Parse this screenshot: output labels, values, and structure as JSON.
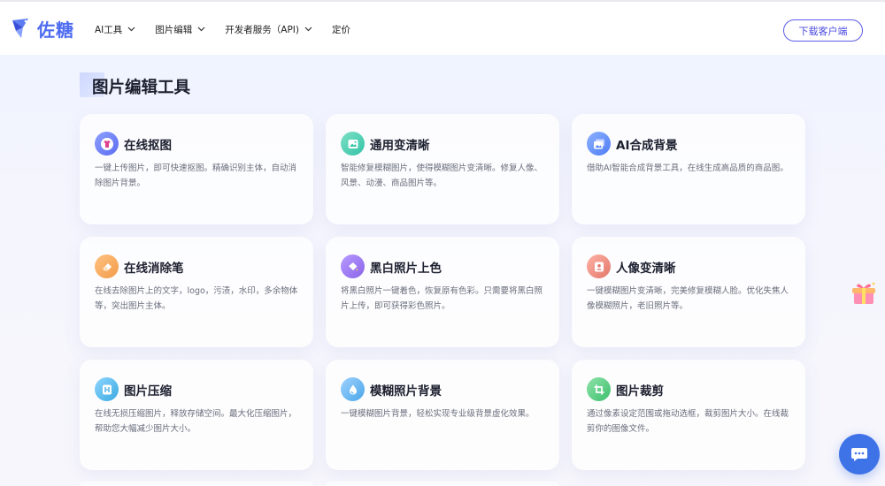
{
  "brand": {
    "name": "佐糖",
    "logo_icon": "bird-logo-icon",
    "color": "#4e6cf0"
  },
  "nav": {
    "items": [
      {
        "label": "AI工具",
        "has_dropdown": true
      },
      {
        "label": "图片编辑",
        "has_dropdown": true
      },
      {
        "label": "开发者服务（API)",
        "has_dropdown": true
      },
      {
        "label": "定价",
        "has_dropdown": false
      }
    ],
    "download_label": "下载客户端"
  },
  "section": {
    "title": "图片编辑工具"
  },
  "cards": [
    {
      "title": "在线抠图",
      "desc": "一键上传图片，即可快速抠图。精确识别主体，自动消除图片背景。",
      "icon": "shirt-icon",
      "color": "#5a6cf0"
    },
    {
      "title": "通用变清晰",
      "desc": "智能修复模糊图片，使得模糊图片变清晰。修复人像、风景、动漫、商品图片等。",
      "icon": "image-icon",
      "color": "#34c3a6"
    },
    {
      "title": "AI合成背景",
      "desc": "借助AI智能合成背景工具，在线生成高品质的商品图。",
      "icon": "photo-stack-icon",
      "color": "#4f7cf5"
    },
    {
      "title": "在线消除笔",
      "desc": "在线去除图片上的文字，logo，污渍，水印，多余物体等，突出图片主体。",
      "icon": "eraser-icon",
      "color": "#f29a47"
    },
    {
      "title": "黑白照片上色",
      "desc": "将黑白照片一键着色，恢复原有色彩。只需要将黑白照片上传，即可获得彩色照片。",
      "icon": "paint-bucket-icon",
      "color": "#8a63e8"
    },
    {
      "title": "人像变清晰",
      "desc": "一键模糊图片变清晰，完美修复模糊人脸。优化失焦人像模糊照片，老旧照片等。",
      "icon": "portrait-icon",
      "color": "#e2766a"
    },
    {
      "title": "图片压缩",
      "desc": "在线无损压缩图片，释放存储空间。最大化压缩图片，帮助您大幅减少图片大小。",
      "icon": "compress-icon",
      "color": "#3aa9e0"
    },
    {
      "title": "模糊照片背景",
      "desc": "一键模糊图片背景，轻松实现专业级背景虚化效果。",
      "icon": "drop-icon",
      "color": "#4aa6e8"
    },
    {
      "title": "图片裁剪",
      "desc": "通过像素设定范围或拖动选框，裁剪图片大小。在线裁剪你的图像文件。",
      "icon": "crop-icon",
      "color": "#3dbf6e"
    }
  ],
  "floaters": {
    "gift_icon": "gift-icon",
    "chat_icon": "chat-bubble-icon",
    "chat_color": "#3e73e8"
  }
}
